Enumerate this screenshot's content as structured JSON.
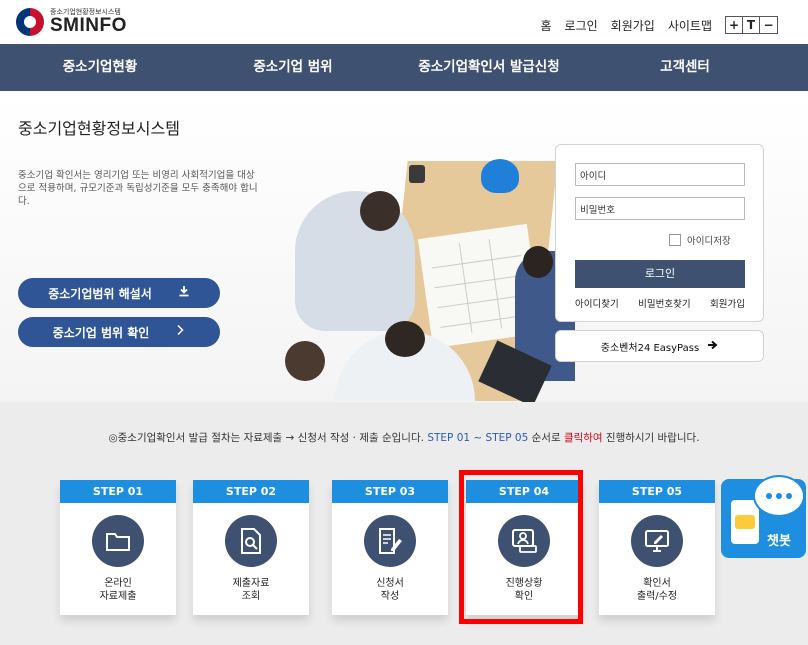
{
  "header": {
    "logo_sub": "중소기업현황정보시스템",
    "logo_main": "SMINFO",
    "util_links": [
      "홈",
      "로그인",
      "회원가입",
      "사이트맵"
    ],
    "font_controls": [
      "+",
      "T",
      "−"
    ]
  },
  "nav": [
    "중소기업현황",
    "중소기업 범위",
    "중소기업확인서 발급신청",
    "고객센터"
  ],
  "hero": {
    "title": "중소기업현황정보시스템",
    "description": "중소기업 확인서는 영리기업 또는 비영리 사회적기업을 대상으로 적용하며, 규모기준과 독립성기준을 모두 충족해야 합니다.",
    "btn_guide": "중소기업범위 해설서",
    "btn_check": "중소기업 범위 확인"
  },
  "login": {
    "id_value": "아이디",
    "pw_value": "비밀번호",
    "save_id": "아이디저장",
    "login_button": "로그인",
    "links": [
      "아이디찾기",
      "비밀번호찾기",
      "회원가입"
    ],
    "easypass": "중소벤처24 EasyPass"
  },
  "notice": {
    "part1": "◎중소기업확인서 발급 절차는 자료제출 → 신청서 작성 · 제출 순입니다. ",
    "part2": "STEP 01 ~ STEP 05",
    "part3": " 순서로 ",
    "part4": "클릭하여",
    "part5": " 진행하시기 바랍니다."
  },
  "steps": [
    {
      "tag": "STEP 01",
      "label": "온라인\n자료제출",
      "icon": "folder-icon"
    },
    {
      "tag": "STEP 02",
      "label": "제출자료\n조회",
      "icon": "document-search-icon"
    },
    {
      "tag": "STEP 03",
      "label": "신청서\n작성",
      "icon": "document-edit-icon"
    },
    {
      "tag": "STEP 04",
      "label": "진행상황\n확인",
      "icon": "user-monitor-icon"
    },
    {
      "tag": "STEP 05",
      "label": "확인서\n출력/수정",
      "icon": "monitor-edit-icon"
    }
  ],
  "chatbot": {
    "label": "챗봇"
  },
  "colors": {
    "nav": "#3e5170",
    "step_tag": "#1e8fe0",
    "highlight": "#ff0000",
    "button": "#2f5596"
  }
}
